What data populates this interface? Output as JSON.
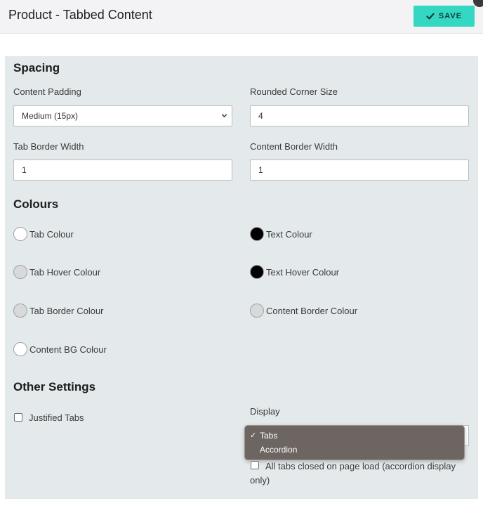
{
  "header": {
    "title": "Product - Tabbed Content",
    "save_label": "SAVE"
  },
  "sections": {
    "spacing": "Spacing",
    "colours": "Colours",
    "other": "Other Settings"
  },
  "spacing": {
    "content_padding": {
      "label": "Content Padding",
      "value": "Medium (15px)"
    },
    "rounded_corner": {
      "label": "Rounded Corner Size",
      "value": "4"
    },
    "tab_border_width": {
      "label": "Tab Border Width",
      "value": "1"
    },
    "content_border_width": {
      "label": "Content Border Width",
      "value": "1"
    }
  },
  "colours": [
    {
      "label": "Tab Colour",
      "color": "#ffffff"
    },
    {
      "label": "Text Colour",
      "color": "#000000"
    },
    {
      "label": "Tab Hover Colour",
      "color": "#d7d9da"
    },
    {
      "label": "Text Hover Colour",
      "color": "#000000"
    },
    {
      "label": "Tab Border Colour",
      "color": "#d7d9da"
    },
    {
      "label": "Content Border Colour",
      "color": "#d7d9da"
    },
    {
      "label": "Content BG Colour",
      "color": "#ffffff"
    }
  ],
  "other": {
    "justified_tabs": {
      "label": "Justified Tabs",
      "checked": false
    },
    "display": {
      "label": "Display",
      "options": [
        "Tabs",
        "Accordion"
      ],
      "selected": "Tabs"
    },
    "all_tabs_closed": {
      "label": "All tabs closed on page load (accordion display only)",
      "checked": false
    }
  },
  "icons": {
    "save": "check-icon",
    "dropdown": "chevron-down-icon"
  },
  "theme": {
    "accent": "#34d7c2",
    "panel_bg": "#e4eaeb"
  }
}
